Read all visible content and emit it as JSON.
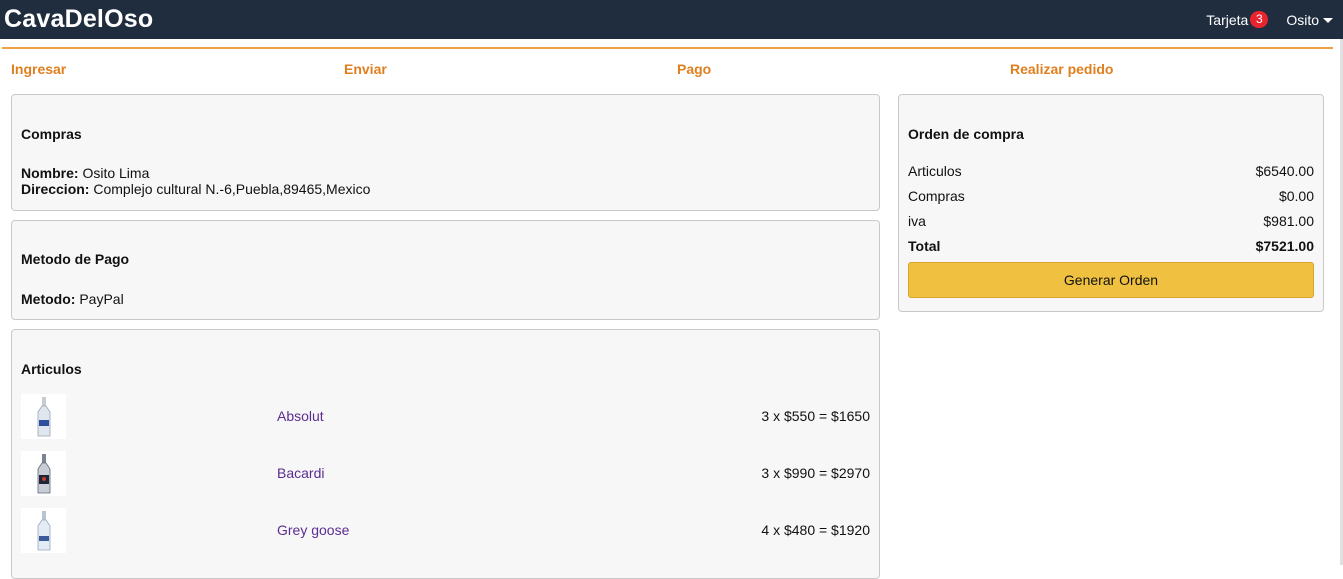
{
  "navbar": {
    "brand": "CavaDelOso",
    "cart_label": "Tarjeta",
    "cart_count": "3",
    "user_label": "Osito"
  },
  "steps": [
    "Ingresar",
    "Enviar",
    "Pago",
    "Realizar pedido"
  ],
  "shipping": {
    "title": "Compras",
    "name_label": "Nombre:",
    "name_value": "Osito Lima",
    "address_label": "Direccion:",
    "address_value": "Complejo cultural N.-6,Puebla,89465,Mexico"
  },
  "payment": {
    "title": "Metodo de Pago",
    "method_label": "Metodo:",
    "method_value": "PayPal"
  },
  "items": {
    "title": "Articulos",
    "list": [
      {
        "name": "Absolut",
        "calc": "3 x $550 = $1650"
      },
      {
        "name": "Bacardi",
        "calc": "3 x $990 = $2970"
      },
      {
        "name": "Grey goose",
        "calc": "4 x $480 = $1920"
      }
    ]
  },
  "summary": {
    "title": "Orden de compra",
    "rows": [
      {
        "label": "Articulos",
        "value": "$6540.00"
      },
      {
        "label": "Compras",
        "value": "$0.00"
      },
      {
        "label": "iva",
        "value": "$981.00"
      }
    ],
    "total_label": "Total",
    "total_value": "$7521.00",
    "button_label": "Generar Orden"
  },
  "colors": {
    "navbar": "#1f2d3f",
    "accent": "#e07f1f",
    "button": "#f0c040",
    "link": "#5c2d91",
    "badge": "#e8242f"
  },
  "icons": [
    "caret-down-icon",
    "bottle-icon"
  ]
}
